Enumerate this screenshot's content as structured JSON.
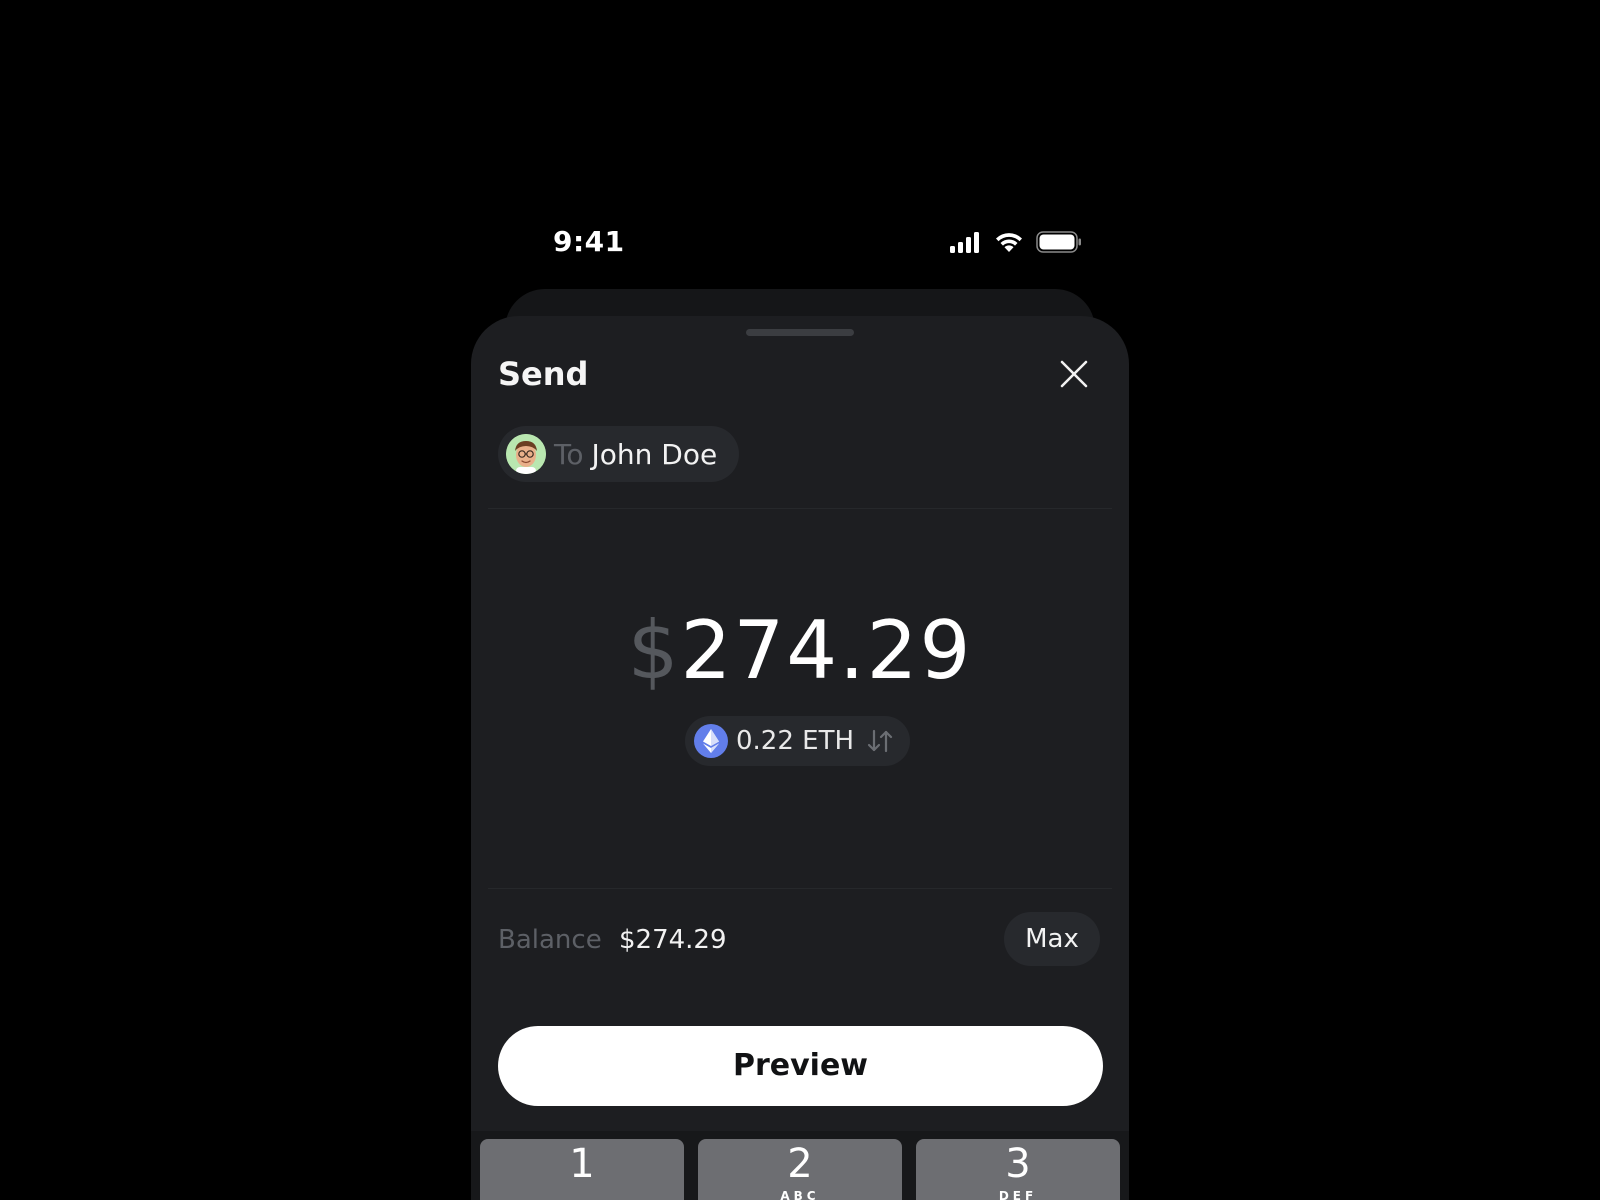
{
  "status_bar": {
    "time": "9:41",
    "icons": [
      "cellular-signal-icon",
      "wifi-icon",
      "battery-icon"
    ]
  },
  "sheet": {
    "title": "Send",
    "close_icon": "close-icon"
  },
  "recipient": {
    "prefix": "To",
    "name": "John Doe",
    "avatar": "memoji-avatar"
  },
  "amount": {
    "currency_symbol": "$",
    "value": "274.29"
  },
  "crypto": {
    "amount": "0.22 ETH",
    "icon": "ethereum-icon",
    "swap_icon": "swap-arrows-icon"
  },
  "balance": {
    "label": "Balance",
    "value": "$274.29",
    "max_label": "Max"
  },
  "actions": {
    "preview_label": "Preview"
  },
  "keypad": {
    "keys": [
      {
        "number": "1",
        "letters": ""
      },
      {
        "number": "2",
        "letters": "ABC"
      },
      {
        "number": "3",
        "letters": "DEF"
      }
    ]
  },
  "colors": {
    "background": "#000000",
    "sheet": "#1d1e21",
    "chip": "#27292d",
    "muted_text": "#5d6066",
    "eth_blue": "#627eea",
    "avatar_bg": "#b9e7b0",
    "key": "#6d6e72"
  }
}
